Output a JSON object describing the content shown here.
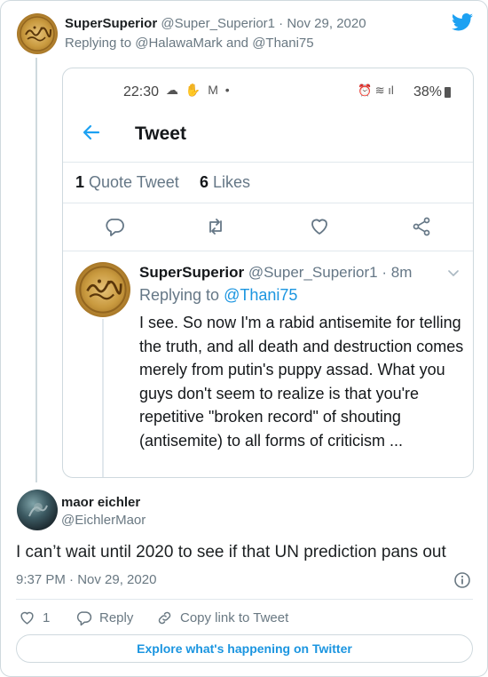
{
  "parent_tweet": {
    "name": "SuperSuperior",
    "handle": "@Super_Superior1",
    "sep": "·",
    "date": "Nov 29, 2020",
    "replying_prefix": "Replying to",
    "reply_to_1": "@HalawaMark",
    "and": "and",
    "reply_to_2": "@Thani75"
  },
  "screenshot": {
    "status_time": "22:30",
    "status_battery": "38%",
    "header_title": "Tweet",
    "quote_count": "1",
    "quote_label": "Quote Tweet",
    "likes_count": "6",
    "likes_label": "Likes",
    "inner_tweet": {
      "name": "SuperSuperior",
      "handle": "@Super_Superior1",
      "sep": "·",
      "age": "8m",
      "replying_prefix": "Replying to",
      "reply_to": "@Thani75",
      "body": "I see. So now I'm a rabid antisemite for telling the truth, and all death and destruction comes merely from putin's puppy assad. What you guys don't seem to realize is that you're repetitive \"broken record\" of shouting (antisemite) to all forms of criticism ..."
    }
  },
  "reply_tweet": {
    "name": "maor eichler",
    "handle": "@EichlerMaor",
    "text": "I can’t wait until 2020 to see if that UN prediction pans out",
    "timestamp": "9:37 PM · Nov 29, 2020",
    "like_count": "1",
    "reply_label": "Reply",
    "copy_link_label": "Copy link to Tweet",
    "explore_label": "Explore what's happening on Twitter"
  },
  "colors": {
    "twitter_blue": "#1da1f2",
    "link_blue": "#1b95e0",
    "muted": "#697882"
  },
  "icons": [
    "twitter-bird-icon",
    "back-arrow-icon",
    "reply-icon",
    "retweet-icon",
    "heart-icon",
    "share-icon",
    "chevron-down-icon",
    "info-icon"
  ]
}
